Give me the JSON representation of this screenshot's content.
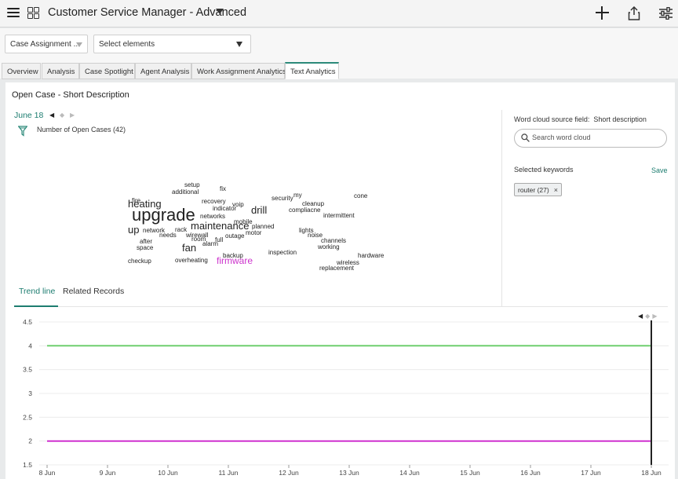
{
  "header": {
    "title": "Customer Service Manager - Advanced",
    "icons": [
      "hamburger-icon",
      "grid-icon",
      "caret-down-icon",
      "plus-icon",
      "share-icon",
      "sliders-icon"
    ]
  },
  "filters": {
    "select1": "Case Assignment ...",
    "select2": "Select elements"
  },
  "tabs": [
    {
      "label": "Overview"
    },
    {
      "label": "Analysis"
    },
    {
      "label": "Case Spotlight"
    },
    {
      "label": "Agent Analysis"
    },
    {
      "label": "Work Assignment Analytics"
    },
    {
      "label": "Text Analytics",
      "active": true
    }
  ],
  "panel": {
    "title": "Open Case - Short Description",
    "date": "June 18",
    "open_cases_label": "Number of Open Cases (42)"
  },
  "word_cloud": {
    "words": [
      {
        "text": "setup",
        "color": "#222222"
      },
      {
        "text": "fix",
        "color": "#222222"
      },
      {
        "text": "additional",
        "color": "#222222"
      },
      {
        "text": "my",
        "color": "#222222"
      },
      {
        "text": "security",
        "color": "#222222"
      },
      {
        "text": "cone",
        "color": "#222222"
      },
      {
        "text": "fire",
        "color": "#222222"
      },
      {
        "text": "heating",
        "color": "#222222"
      },
      {
        "text": "recovery",
        "color": "#222222"
      },
      {
        "text": "voip",
        "color": "#222222"
      },
      {
        "text": "cleanup",
        "color": "#222222"
      },
      {
        "text": "indicator",
        "color": "#222222"
      },
      {
        "text": "drill",
        "color": "#222222"
      },
      {
        "text": "compliacne",
        "color": "#222222"
      },
      {
        "text": "upgrade",
        "color": "#222222"
      },
      {
        "text": "networks",
        "color": "#222222"
      },
      {
        "text": "intermittent",
        "color": "#222222"
      },
      {
        "text": "mobile",
        "color": "#222222"
      },
      {
        "text": "maintenance",
        "color": "#222222"
      },
      {
        "text": "planned",
        "color": "#222222"
      },
      {
        "text": "up",
        "color": "#222222"
      },
      {
        "text": "network",
        "color": "#222222"
      },
      {
        "text": "rack",
        "color": "#222222"
      },
      {
        "text": "lights",
        "color": "#222222"
      },
      {
        "text": "wirewall",
        "color": "#222222"
      },
      {
        "text": "motor",
        "color": "#222222"
      },
      {
        "text": "needs",
        "color": "#222222"
      },
      {
        "text": "outage",
        "color": "#222222"
      },
      {
        "text": "noise",
        "color": "#222222"
      },
      {
        "text": "room",
        "color": "#222222"
      },
      {
        "text": "full",
        "color": "#222222"
      },
      {
        "text": "channels",
        "color": "#222222"
      },
      {
        "text": "after",
        "color": "#222222"
      },
      {
        "text": "alarm",
        "color": "#222222"
      },
      {
        "text": "space",
        "color": "#222222"
      },
      {
        "text": "fan",
        "color": "#222222"
      },
      {
        "text": "working",
        "color": "#222222"
      },
      {
        "text": "inspection",
        "color": "#222222"
      },
      {
        "text": "backup",
        "color": "#222222"
      },
      {
        "text": "hardware",
        "color": "#222222"
      },
      {
        "text": "checkup",
        "color": "#222222"
      },
      {
        "text": "overheating",
        "color": "#222222"
      },
      {
        "text": "firmware",
        "color": "#cc33cc"
      },
      {
        "text": "wireless",
        "color": "#222222"
      },
      {
        "text": "replacement",
        "color": "#222222"
      }
    ]
  },
  "right_panel": {
    "source_label": "Word cloud source field:",
    "source_value": "Short description",
    "search_placeholder": "Search word cloud",
    "selected_label": "Selected keywords",
    "save_label": "Save",
    "chip_label": "router (27)",
    "chip_close": "×"
  },
  "subtabs": [
    {
      "label": "Trend line",
      "active": true
    },
    {
      "label": "Related Records"
    }
  ],
  "chart_data": {
    "type": "line",
    "x": [
      "8 Jun",
      "9 Jun",
      "10 Jun",
      "11 Jun",
      "12 Jun",
      "13 Jun",
      "14 Jun",
      "15 Jun",
      "16 Jun",
      "17 Jun",
      "18 Jun"
    ],
    "series": [
      {
        "color": "#66cc66",
        "values": [
          4,
          4,
          4,
          4,
          4,
          4,
          4,
          4,
          4,
          4,
          4
        ]
      },
      {
        "color": "#cc22cc",
        "values": [
          2,
          2,
          2,
          2,
          2,
          2,
          2,
          2,
          2,
          2,
          2
        ]
      }
    ],
    "yticks": [
      "4.5",
      "4",
      "3.5",
      "3",
      "2.5",
      "2",
      "1.5"
    ],
    "ylim": [
      1.5,
      4.5
    ],
    "grid": true,
    "marker_at": "18 Jun"
  }
}
